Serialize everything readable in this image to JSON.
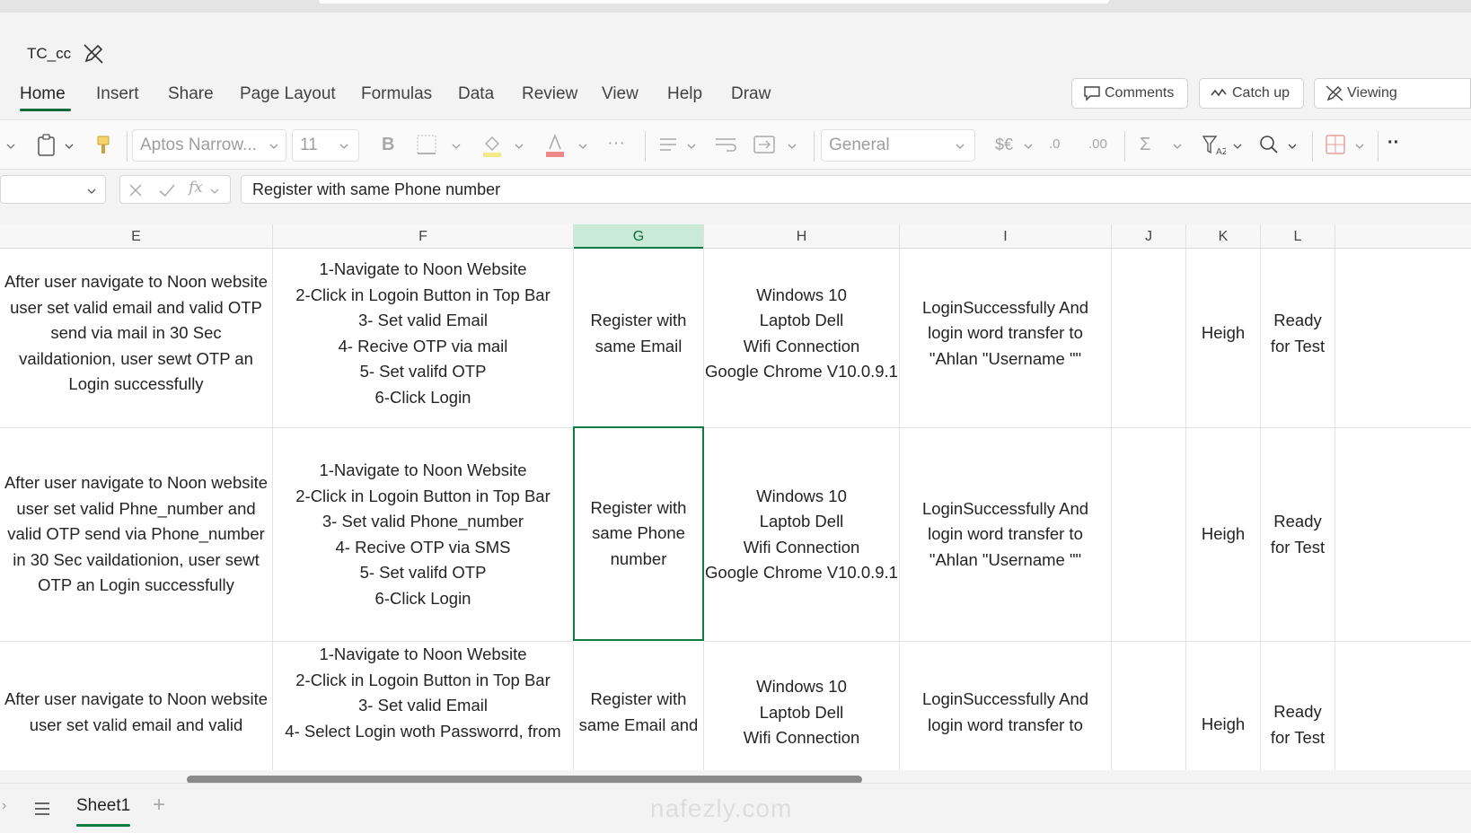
{
  "document": {
    "title": "TC_cc"
  },
  "ribbon_tabs": [
    "Home",
    "Insert",
    "Share",
    "Page Layout",
    "Formulas",
    "Data",
    "Review",
    "View",
    "Help",
    "Draw"
  ],
  "active_tab": "Home",
  "top_buttons": {
    "comments": "Comments",
    "catch_up": "Catch up",
    "viewing": "Viewing"
  },
  "toolbar": {
    "font_name": "Aptos Narrow...",
    "font_size": "11",
    "number_format": "General"
  },
  "formula_bar": {
    "content": "Register with same Phone number"
  },
  "columns": [
    "E",
    "F",
    "G",
    "H",
    "I",
    "J",
    "K",
    "L"
  ],
  "selected_column": "G",
  "rows": [
    {
      "E": "After user navigate to Noon website\nuser set valid email and valid OTP\nsend via mail in 30 Sec\nvaildationion, user sewt OTP an\nLogin successfully",
      "F": "1-Navigate to Noon Website\n2-Click in Logoin Button in Top Bar\n3- Set valid Email\n4- Recive OTP via mail\n5- Set valifd OTP\n6-Click Login",
      "G": "Register with\nsame Email",
      "H": "Windows 10\nLaptob Dell\nWifi Connection\nGoogle Chrome V10.0.9.1",
      "I": "LoginSuccessfully And\nlogin word transfer to\n\"Ahlan \"Username \"\"",
      "J": "",
      "K": "Heigh",
      "L": "Ready\nfor Test"
    },
    {
      "E": "After user navigate to Noon website\nuser set valid Phne_number and\nvalid OTP send via Phone_number\nin 30 Sec vaildationion, user sewt\nOTP an Login successfully",
      "F": "1-Navigate to Noon Website\n2-Click in Logoin Button in Top Bar\n3- Set valid Phone_number\n4- Recive OTP via SMS\n5- Set valifd OTP\n6-Click Login",
      "G": "Register with\nsame Phone\nnumber",
      "H": "Windows 10\nLaptob Dell\nWifi Connection\nGoogle Chrome V10.0.9.1",
      "I": "LoginSuccessfully And\nlogin word transfer to\n\"Ahlan \"Username \"\"",
      "J": "",
      "K": "Heigh",
      "L": "Ready\nfor Test"
    },
    {
      "E": "After user navigate to Noon website\nuser set valid email and valid",
      "F": "1-Navigate to Noon Website\n2-Click in Logoin Button in Top Bar\n3- Set valid Email\n4- Select Login woth Passworrd, from",
      "G": "Register with\nsame Email and",
      "H": "Windows 10\nLaptob Dell\nWifi Connection",
      "I": "LoginSuccessfully And\nlogin word transfer to",
      "J": "",
      "K": "Heigh",
      "L": "Ready\nfor Test"
    }
  ],
  "sheets": [
    "Sheet1"
  ],
  "watermark": "nafezly.com",
  "colors": {
    "accent": "#107c41",
    "selected_header": "#caead7"
  },
  "icons": [
    "no-edit-icon",
    "comment-icon",
    "catch-up-icon",
    "viewing-icon",
    "paste-icon",
    "format-painter-icon",
    "bold-icon",
    "borders-icon",
    "fill-color-icon",
    "font-color-icon",
    "more-icon",
    "align-icon",
    "wrap-text-icon",
    "merge-icon",
    "currency-icon",
    "decrease-decimal-icon",
    "increase-decimal-icon",
    "autosum-icon",
    "sort-filter-icon",
    "find-icon",
    "conditional-format-icon",
    "cancel-icon",
    "enter-icon",
    "function-icon",
    "sheet-menu-icon",
    "add-sheet-icon"
  ]
}
